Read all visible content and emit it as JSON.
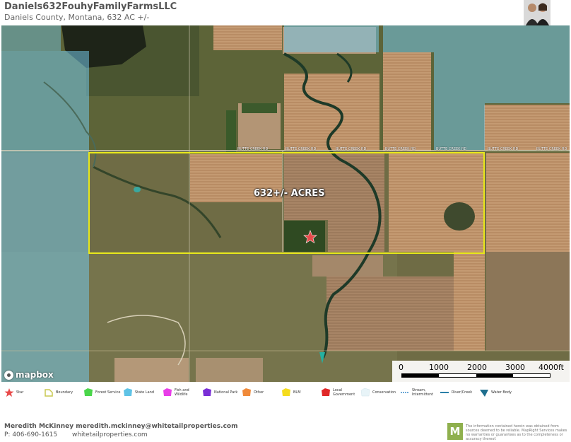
{
  "header": {
    "title": "Daniels632FouhyFamilyFarmsLLC",
    "subtitle": "Daniels County, Montana, 632 AC +/-"
  },
  "map": {
    "property_label": "632+/- ACRES",
    "road_label": "BUTTE CREEK RD",
    "attribution": "mapbox",
    "boundary_color": "#e8e81a",
    "state_land_color": "#74c6e8",
    "marker": "star-icon"
  },
  "scale": {
    "labels": [
      "0",
      "1000",
      "2000",
      "3000",
      "4000ft"
    ]
  },
  "legend": [
    {
      "label": "Star",
      "icon": "star-icon",
      "color": "#e84a4a"
    },
    {
      "label": "Boundary",
      "icon": "boundary-icon",
      "color": "#c8c850"
    },
    {
      "label": "Forest Service",
      "icon": "forest-service-icon",
      "color": "#4bd64b"
    },
    {
      "label": "State Land",
      "icon": "state-land-icon",
      "color": "#5fc3e6"
    },
    {
      "label": "Fish and Wildlife",
      "icon": "fish-wildlife-icon",
      "color": "#e83ee8"
    },
    {
      "label": "National Park",
      "icon": "national-park-icon",
      "color": "#7a2fd6"
    },
    {
      "label": "Other",
      "icon": "other-icon",
      "color": "#f08a3a"
    },
    {
      "label": "BLM",
      "icon": "blm-icon",
      "color": "#f5dc1e"
    },
    {
      "label": "Local Government",
      "icon": "local-government-icon",
      "color": "#e02828"
    },
    {
      "label": "Conservation",
      "icon": "conservation-icon",
      "color": "#e8f4f8"
    },
    {
      "label": "Stream, Intermittent",
      "icon": "stream-intermittent-icon",
      "color": "#3a8cc8"
    },
    {
      "label": "River/Creek",
      "icon": "river-creek-icon",
      "color": "#2a7fa8"
    },
    {
      "label": "Water Body",
      "icon": "water-body-icon",
      "color": "#1f6f8f"
    }
  ],
  "footer": {
    "agent": "Meredith McKinney meredith.mckinney@whitetailproperties.com",
    "phone": "P: 406-690-1615",
    "website": "whitetailproperties.com",
    "logo_letter": "M",
    "disclaimer": "The information contained herein was obtained from sources deemed to be reliable. MapRight Services makes no warranties or guarantees as to the completeness or accuracy thereof."
  }
}
